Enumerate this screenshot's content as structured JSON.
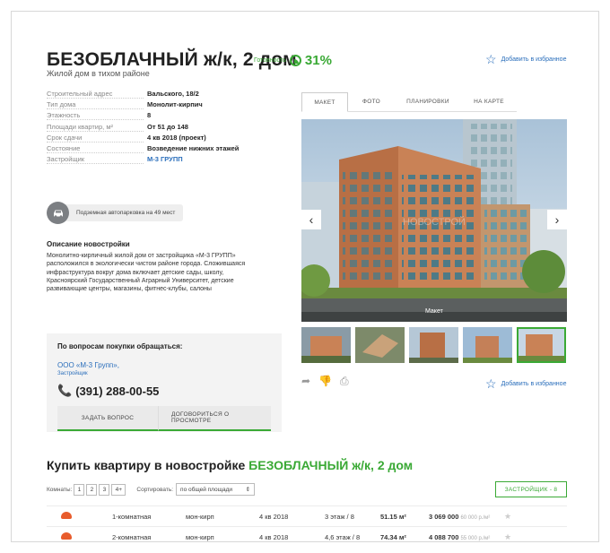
{
  "header": {
    "title": "БЕЗОБЛАЧНЫЙ ж/к, 2 дом",
    "readiness_label": "Готовность",
    "readiness_value": "31%",
    "subtitle": "Жилой дом в тихом районе",
    "favorite_label": "Добавить в избранное"
  },
  "specs": [
    {
      "label": "Строительный адрес",
      "value": "Вальского, 18/2"
    },
    {
      "label": "Тип дома",
      "value": "Монолит-кирпич"
    },
    {
      "label": "Этажность",
      "value": "8"
    },
    {
      "label": "Площади квартир, м²",
      "value": "От 51 до 148"
    },
    {
      "label": "Срок сдачи",
      "value": "4 кв 2018 (проект)"
    },
    {
      "label": "Состояние",
      "value": "Возведение нижних этажей"
    },
    {
      "label": "Застройщик",
      "value": "М-3 ГРУПП"
    }
  ],
  "parking": {
    "text": "Подземная автопарковка на 49 мест",
    "icon": "car-icon"
  },
  "description": {
    "title": "Описание новостройки",
    "text": "Монолитно-кирпичный жилой дом от застройщика «М-3 ГРУПП» расположился в экологически чистом районе города. Сложившаяся инфраструктура вокруг дома включает детские сады, школу, Красноярский Государственный Аграрный Университет, детские развивающие центры, магазины, фитнес-клубы, салоны"
  },
  "contact": {
    "title": "По вопросам покупки обращаться:",
    "company": "ООО «М-3 Групп»,",
    "role": "Застройщик",
    "phone": "(391) 288-00-55",
    "ask_button": "ЗАДАТЬ ВОПРОС",
    "viewing_button": "ДОГОВОРИТЬСЯ О ПРОСМОТРЕ"
  },
  "gallery": {
    "tabs": [
      "МАКЕТ",
      "ФОТО",
      "ПЛАНИРОВКИ",
      "НА КАРТЕ"
    ],
    "active_tab": 0,
    "caption": "Макет",
    "watermark": "НОВОСТРОЙ",
    "favorite_label": "Добавить в избранное"
  },
  "buy": {
    "title_prefix": "Купить квартиру в новостройке ",
    "title_highlight": "БЕЗОБЛАЧНЫЙ ж/к, 2 дом",
    "rooms_label": "Комнаты:",
    "room_options": [
      "1",
      "2",
      "3",
      "4+"
    ],
    "sort_label": "Сортировать:",
    "sort_value": "по общей площади",
    "builder_button": "ЗАСТРОЙЩИК - 8"
  },
  "apartments": [
    {
      "rooms": "1-комнатная",
      "type": "мон-кирп",
      "date": "4 кв 2018",
      "floor": "3 этаж / 8",
      "area": "51.15 м²",
      "price": "3 069 000",
      "per_m": "60 000 р./м²"
    },
    {
      "rooms": "2-комнатная",
      "type": "мон-кирп",
      "date": "4 кв 2018",
      "floor": "4,6 этаж / 8",
      "area": "74.34 м²",
      "price": "4 088 700",
      "per_m": "55 000 р./м²"
    }
  ],
  "colors": {
    "accent": "#3aa935",
    "link": "#2a6ebb",
    "brick": "#c98256"
  }
}
